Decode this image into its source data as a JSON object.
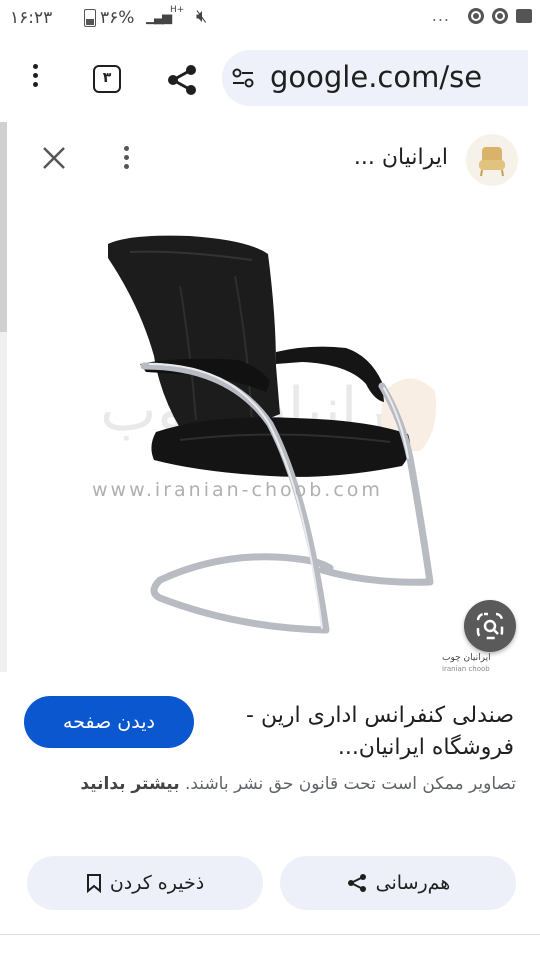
{
  "status": {
    "time": "۱۶:۲۳",
    "battery": "۳۶%",
    "network": "H+",
    "overflow_dots": "..."
  },
  "toolbar": {
    "tab_count": "۳",
    "url": "google.com/se"
  },
  "panel": {
    "site_name": "ایرانیان ..."
  },
  "image": {
    "watermark_url": "www.iranian-choob.com",
    "favicon_text": "ایرانیان چوب",
    "favicon_sub": "iranian choob"
  },
  "result": {
    "title": "صندلی کنفرانس اداری ارین - فروشگاه ایرانیان...",
    "visit_label": "دیدن صفحه",
    "copyright_text": "تصاویر ممکن است تحت قانون حق نشر باشند.",
    "learn_more": "بیشتر بدانید",
    "save_label": "ذخیره کردن",
    "share_label": "هم‌رسانی"
  },
  "colors": {
    "accent": "#0b57d0",
    "button_bg": "#edf0f8",
    "url_bg": "#eef1f9"
  },
  "icons": [
    "menu-dots-icon",
    "tabs-icon",
    "share-icon",
    "tune-icon",
    "close-icon",
    "more-vert-icon",
    "lens-icon",
    "bookmark-icon",
    "share-small-icon",
    "chrome-icon",
    "message-icon",
    "mute-icon"
  ]
}
